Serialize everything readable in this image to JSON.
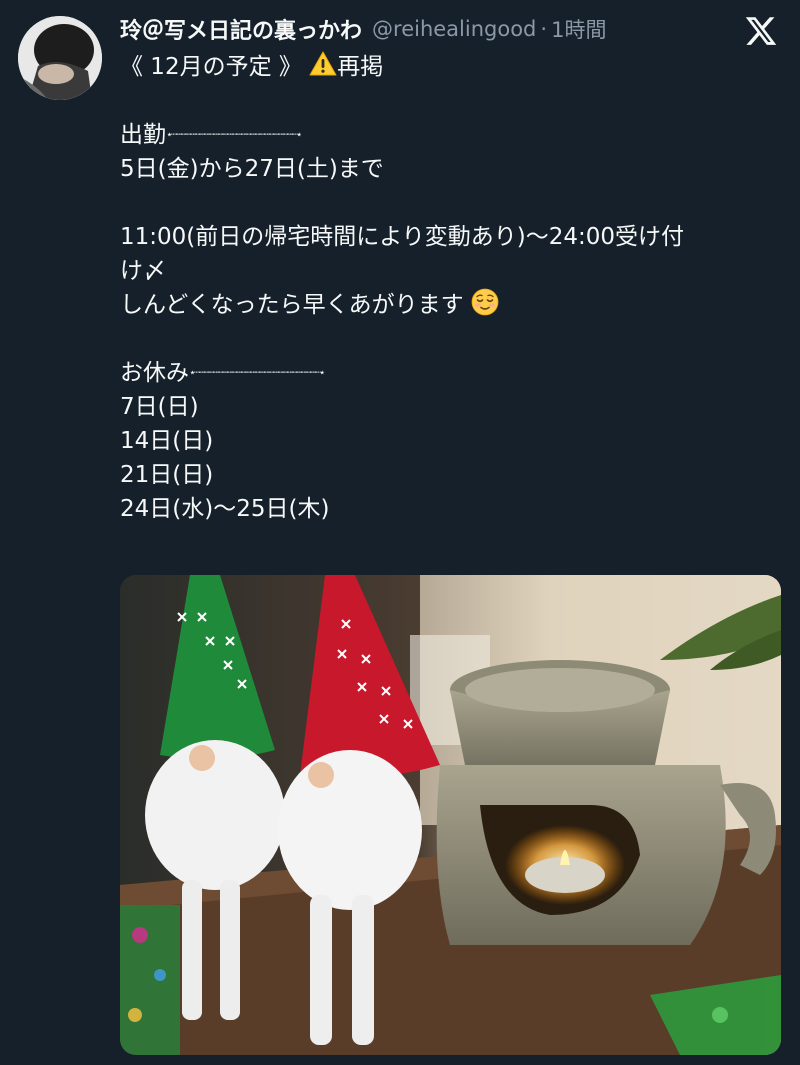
{
  "tweet": {
    "author": {
      "display_name": "玲＠写メ日記の裏っかわ",
      "handle": "@reihealingood",
      "separator": "·",
      "time_ago": "1時間"
    },
    "lines": {
      "title": "《 12月の予定 》",
      "title_suffix": "再掲",
      "section1_label": "出勤",
      "work_days": "5日(金)から27日(土)まで",
      "hours_line1": "11:00(前日の帰宅時間により変動あり)〜24:00受け付",
      "hours_line2": "け〆",
      "early_leave": "しんどくなったら早くあがります",
      "section2_label": "お休み",
      "off1": "7日(日)",
      "off2": "14日(日)",
      "off3": "21日(日)",
      "off4": "24日(水)〜25日(木)"
    },
    "dotted_separator": "⋆┈┈┈┈┈┈┈┈┈┈┈┈┈┈┈┈┈┈┈┈┈┈┈┈┈┈┈⋆",
    "icons": {
      "warning": "warning-emoji",
      "relieved": "relieved-face-emoji",
      "x_logo": "x-logo-icon"
    },
    "colors": {
      "background": "#15202b",
      "text_primary": "#f7f9f9",
      "text_secondary": "#8b98a5"
    }
  }
}
